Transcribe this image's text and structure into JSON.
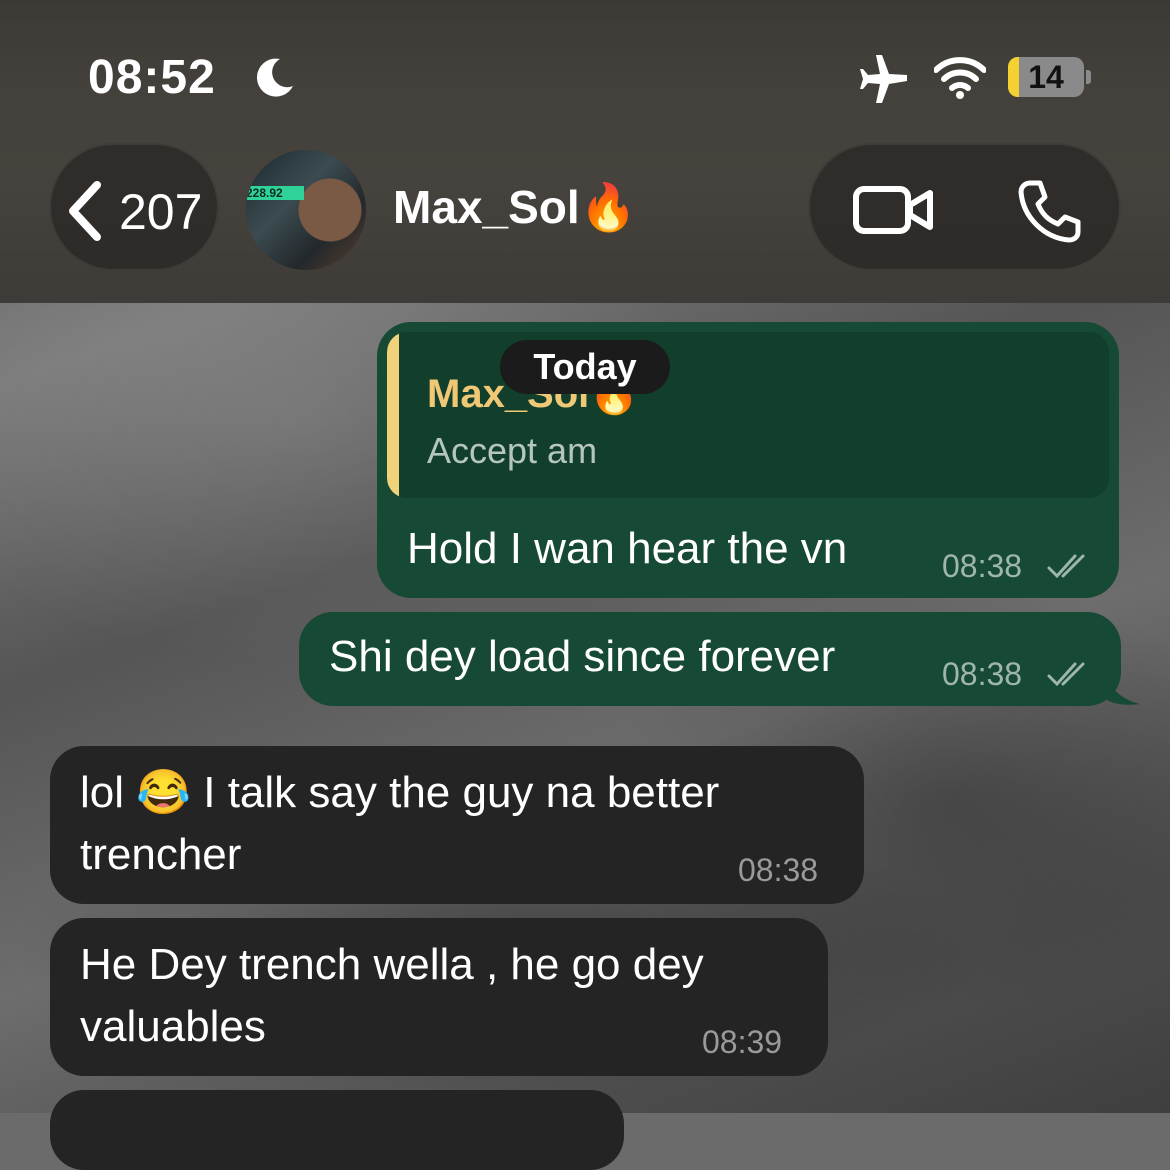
{
  "status_bar": {
    "time": "08:52",
    "battery": "14",
    "battery_fraction": 0.14
  },
  "header": {
    "back_count": "207",
    "contact_name": "Max_Sol🔥",
    "avatar_price": "228.92"
  },
  "date_divider": "Today",
  "messages": [
    {
      "direction": "outgoing",
      "reply_to": {
        "name": "Max_Sol🔥",
        "text": "Accept am"
      },
      "text": "Hold I wan hear the vn",
      "time": "08:38",
      "status": "read"
    },
    {
      "direction": "outgoing",
      "text": "Shi dey load since forever",
      "time": "08:38",
      "status": "read"
    },
    {
      "direction": "incoming",
      "text_line1": "lol 😂 I talk say the guy na better",
      "text_line2": "trencher",
      "time": "08:38"
    },
    {
      "direction": "incoming",
      "text_line1": "He Dey trench wella , he go dey",
      "text_line2": "valuables",
      "time": "08:39"
    }
  ],
  "colors": {
    "outgoing_bubble": "#164a35",
    "incoming_bubble": "#242424",
    "reply_accent": "#f0d27a",
    "battery_fill": "#f4d130"
  },
  "icons": [
    "moon-icon",
    "airplane-icon",
    "wifi-icon",
    "battery-icon",
    "back-chevron-icon",
    "video-call-icon",
    "phone-call-icon",
    "double-check-icon"
  ]
}
